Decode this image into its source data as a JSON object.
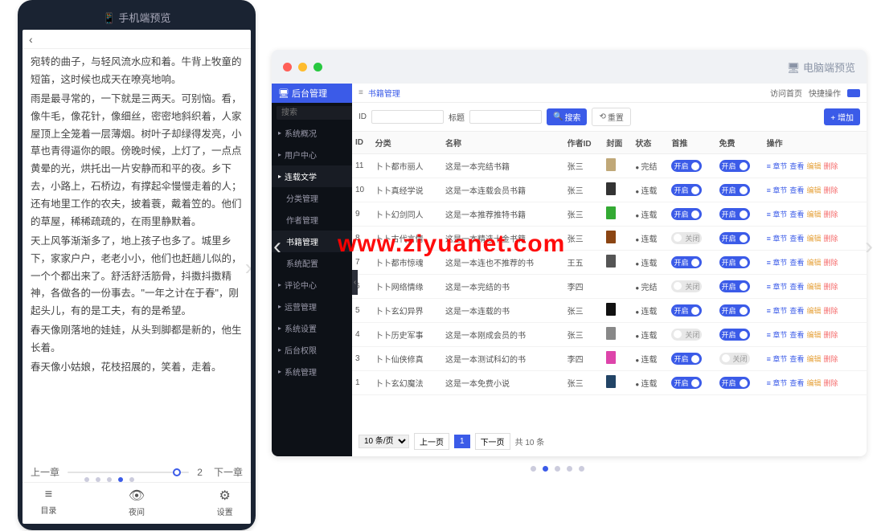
{
  "mobile": {
    "title": "📱 手机端预览",
    "back": "‹",
    "paragraphs": [
      "宛转的曲子，与轻风流水应和着。牛背上牧童的短笛，这时候也成天在嘹亮地响。",
      "雨是最寻常的，一下就是三两天。可别恼。看，像牛毛，像花针，像细丝，密密地斜织着，人家屋顶上全笼着一层薄烟。树叶子却绿得发亮，小草也青得逼你的眼。傍晚时候，上灯了，一点点黄晕的光，烘托出一片安静而和平的夜。乡下去，小路上，石桥边，有撑起伞慢慢走着的人；还有地里工作的农夫，披着蓑，戴着笠的。他们的草屋，稀稀疏疏的，在雨里静默着。",
      "天上风筝渐渐多了，地上孩子也多了。城里乡下，家家户户，老老小小，他们也赶趟儿似的，一个个都出来了。舒活舒活筋骨，抖擞抖擞精神，各做各的一份事去。\"一年之计在于春\"，刚起头儿，有的是工夫，有的是希望。",
      "春天像刚落地的娃娃，从头到脚都是新的，他生长着。",
      "春天像小姑娘，花枝招展的，笑着，走着。"
    ],
    "prev": "上一章",
    "next": "下一章",
    "page_num": "2",
    "nav": [
      {
        "label": "目录",
        "name": "toc-icon"
      },
      {
        "label": "",
        "name": "blank-icon"
      },
      {
        "label": "夜间",
        "name": "eye-icon"
      },
      {
        "label": "",
        "name": "blank2-icon"
      },
      {
        "label": "设置",
        "name": "gear-icon"
      }
    ]
  },
  "desktop": {
    "title": "🖥 电脑端预览",
    "admin_title": "🖥 后台管理",
    "search_placeholder": "搜索",
    "top_links": [
      "访问首页",
      "快捷操作"
    ],
    "sidebar": {
      "items": [
        {
          "label": "系统概况",
          "icon": true
        },
        {
          "label": "用户中心",
          "icon": true
        },
        {
          "label": "连载文学",
          "icon": true,
          "active": true
        },
        {
          "label": "分类管理",
          "indent": true
        },
        {
          "label": "作者管理",
          "indent": true
        },
        {
          "label": "书籍管理",
          "indent": true,
          "active": true
        },
        {
          "label": "系统配置",
          "indent": true
        },
        {
          "label": "评论中心",
          "icon": true
        },
        {
          "label": "运营管理",
          "icon": true
        },
        {
          "label": "系统设置",
          "icon": true
        },
        {
          "label": "后台权限",
          "icon": true
        },
        {
          "label": "系统管理",
          "icon": true
        }
      ]
    },
    "breadcrumb": "书籍管理",
    "filters": {
      "id_label": "ID",
      "title_label": "标题",
      "search_btn": "搜索",
      "reset_btn": "重置",
      "add_btn": "+ 增加"
    },
    "columns": [
      "ID",
      "分类",
      "名称",
      "作者ID",
      "封面",
      "状态",
      "首推",
      "免费",
      "操作"
    ],
    "rows": [
      {
        "id": "11",
        "cat": "卜卜都市丽人",
        "name": "这是一本完结书籍",
        "author": "张三",
        "cover": "#c0a878",
        "status": "完结",
        "push_on": true,
        "free_on": true
      },
      {
        "id": "10",
        "cat": "卜卜真经学说",
        "name": "这是一本连载会员书籍",
        "author": "张三",
        "cover": "#333",
        "status": "连载",
        "push_on": true,
        "free_on": true
      },
      {
        "id": "9",
        "cat": "卜卜幻剑同人",
        "name": "这是一本推荐推特书籍",
        "author": "张三",
        "cover": "#3a3",
        "status": "连载",
        "push_on": true,
        "free_on": true
      },
      {
        "id": "8",
        "cat": "卜卜古代言情",
        "name": "这是一本精选十金书籍",
        "author": "张三",
        "cover": "#8b4513",
        "status": "连载",
        "push_on": false,
        "free_on": true
      },
      {
        "id": "7",
        "cat": "卜卜都市惊魂",
        "name": "这是一本连也不推荐的书",
        "author": "王五",
        "cover": "#555",
        "status": "连载",
        "push_on": true,
        "free_on": true
      },
      {
        "id": "6",
        "cat": "卜卜网络情缘",
        "name": "这是一本完结的书",
        "author": "李四",
        "cover": "#fff",
        "status": "完结",
        "push_on": false,
        "free_on": true
      },
      {
        "id": "5",
        "cat": "卜卜玄幻异界",
        "name": "这是一本连载的书",
        "author": "张三",
        "cover": "#111",
        "status": "连载",
        "push_on": true,
        "free_on": true
      },
      {
        "id": "4",
        "cat": "卜卜历史军事",
        "name": "这是一本刚成会员的书",
        "author": "张三",
        "cover": "#888",
        "status": "连载",
        "push_on": false,
        "free_on": true
      },
      {
        "id": "3",
        "cat": "卜卜仙侠修真",
        "name": "这是一本测试科幻的书",
        "author": "李四",
        "cover": "#d4a",
        "status": "连载",
        "push_on": true,
        "free_on": false
      },
      {
        "id": "1",
        "cat": "卜卜玄幻魔法",
        "name": "这是一本免费小说",
        "author": "张三",
        "cover": "#246",
        "status": "连载",
        "push_on": true,
        "free_on": true
      }
    ],
    "toggle_on_label": "开启",
    "toggle_off_label": "关闭",
    "action_labels": [
      "章节",
      "查看",
      "编辑",
      "删除"
    ],
    "pagination": {
      "size": "10 条/页",
      "prev": "上一页",
      "page": "1",
      "next": "下一页",
      "total": "共 10 条"
    }
  },
  "watermark": "www.ziyuanet.com"
}
